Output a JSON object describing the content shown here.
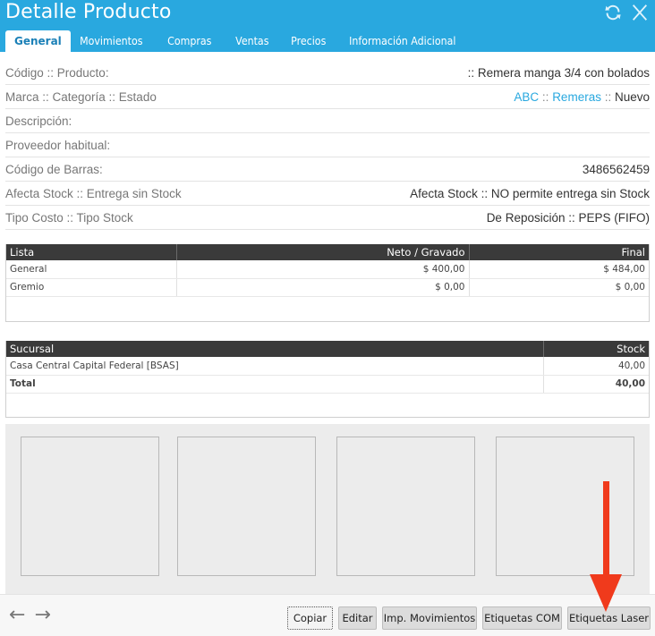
{
  "window": {
    "title": "Detalle Producto",
    "icons": [
      "refresh-icon",
      "close-icon"
    ]
  },
  "tabs": [
    {
      "label": "General",
      "active": true
    },
    {
      "label": "Movimientos"
    },
    {
      "label": "Compras"
    },
    {
      "label": "Ventas"
    },
    {
      "label": "Precios"
    },
    {
      "label": "Información Adicional"
    }
  ],
  "fields": {
    "codigo": {
      "label": "Código :: Producto:",
      "value": ":: Remera manga 3/4 con bolados"
    },
    "marca": {
      "label": "Marca :: Categoría :: Estado",
      "brand": "ABC",
      "sep1": " :: ",
      "category": "Remeras",
      "sep2": " :: ",
      "status": "Nuevo"
    },
    "descripcion": {
      "label": "Descripción:",
      "value": ""
    },
    "proveedor": {
      "label": "Proveedor habitual:",
      "value": ""
    },
    "barras": {
      "label": "Código de Barras:",
      "value": "3486562459"
    },
    "stock": {
      "label": "Afecta Stock :: Entrega sin Stock",
      "value": "Afecta Stock :: NO permite entrega sin Stock"
    },
    "costo": {
      "label": "Tipo Costo :: Tipo Stock",
      "value": "De Reposición :: PEPS (FIFO)"
    }
  },
  "prices": {
    "headers": [
      "Lista",
      "Neto / Gravado",
      "Final"
    ],
    "rows": [
      [
        "General",
        "$ 400,00",
        "$ 484,00"
      ],
      [
        "Gremio",
        "$ 0,00",
        "$ 0,00"
      ]
    ]
  },
  "stock_table": {
    "headers": [
      "Sucursal",
      "Stock"
    ],
    "rows": [
      [
        "Casa Central Capital Federal [BSAS]",
        "40,00"
      ]
    ],
    "total": [
      "Total",
      "40,00"
    ]
  },
  "footer": {
    "buttons": {
      "copiar": "Copiar",
      "editar": "Editar",
      "imp_mov": "Imp. Movimientos",
      "etq_com": "Etiquetas COM",
      "etq_laser": "Etiquetas Laser"
    },
    "nav": {
      "back": "←",
      "forward": "→"
    }
  },
  "colors": {
    "accent": "#29a8df",
    "header_dark": "#3a3a3a",
    "annotation_arrow": "#f03a1c"
  }
}
